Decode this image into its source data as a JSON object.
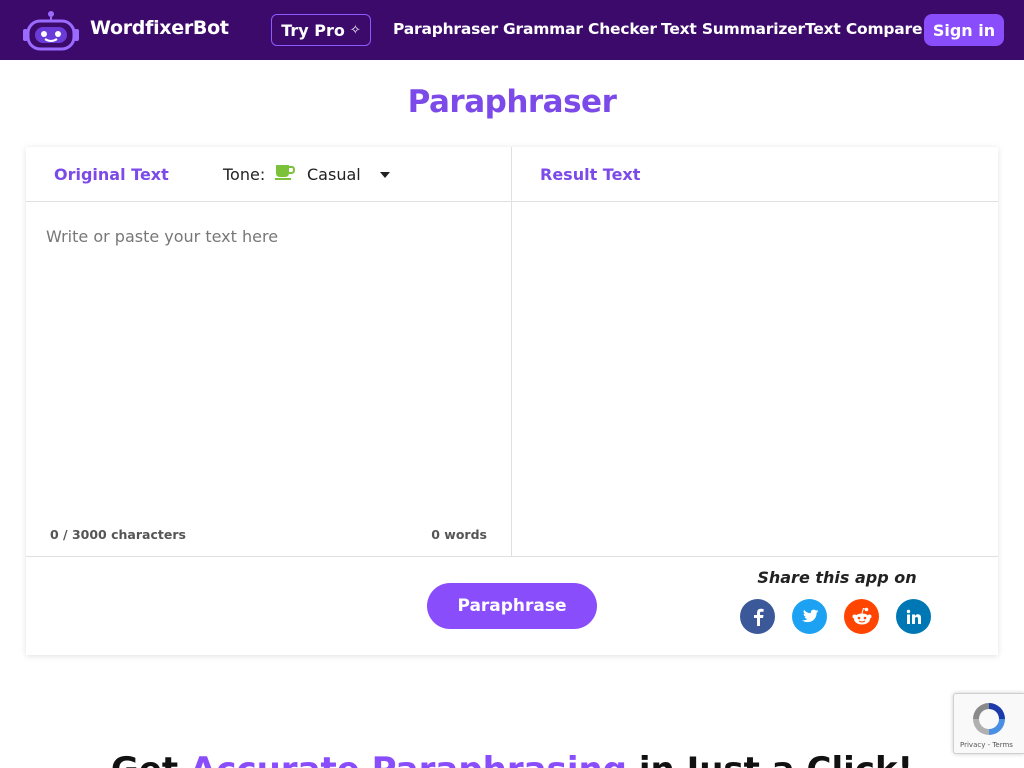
{
  "header": {
    "brand": "WordfixerBot",
    "try_pro": "Try Pro",
    "links": [
      "Paraphraser",
      "Grammar Checker",
      "Text Summarizer",
      "Text Compare"
    ],
    "sign_in": "Sign in"
  },
  "page": {
    "title": "Paraphraser"
  },
  "editor": {
    "original_label": "Original Text",
    "tone_label": "Tone:",
    "tone_value": "Casual",
    "result_label": "Result Text",
    "placeholder": "Write or paste your text here",
    "char_count": "0 / 3000 characters",
    "word_count": "0 words",
    "paraphrase_button": "Paraphrase"
  },
  "share": {
    "label": "Share this app on",
    "networks": [
      "facebook",
      "twitter",
      "reddit",
      "linkedin"
    ]
  },
  "bottom": {
    "heading_pre": "Get",
    "heading_accent": "Accurate Paraphrasing",
    "heading_post": "in Just a Click!"
  },
  "recaptcha": {
    "text": "Privacy - Terms"
  },
  "colors": {
    "nav_bg": "#3b0a6b",
    "accent": "#8a4dfb",
    "title": "#7c4ae8",
    "facebook": "#3b5998",
    "twitter": "#1da1f2",
    "reddit": "#ff4500",
    "linkedin": "#0077b5",
    "tone_icon": "#7cc13a"
  }
}
